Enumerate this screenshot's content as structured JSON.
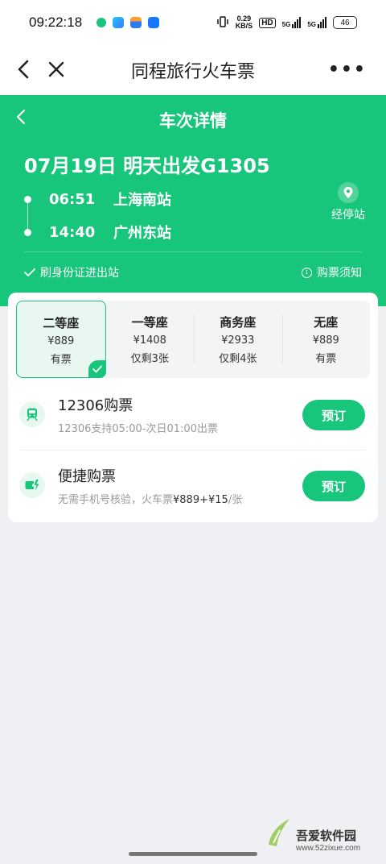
{
  "status_bar": {
    "time": "09:22:18",
    "net_speed_value": "0.29",
    "net_speed_unit": "KB/S",
    "hd": "HD",
    "sig1": "5G",
    "sig2": "5G",
    "battery": "46"
  },
  "nav": {
    "title": "同程旅行火车票",
    "more": "•••"
  },
  "trip": {
    "page_title": "车次详情",
    "date_line": "07月19日 明天出发G1305",
    "depart_time": "06:51",
    "depart_station": "上海南站",
    "arrive_time": "14:40",
    "arrive_station": "广州东站",
    "stops_label": "经停站",
    "id_card_label": "刷身份证进出站",
    "notice_label": "购票须知"
  },
  "seats": [
    {
      "name": "二等座",
      "price": "¥889",
      "stock": "有票",
      "selected": true
    },
    {
      "name": "一等座",
      "price": "¥1408",
      "stock": "仅剩3张",
      "selected": false
    },
    {
      "name": "商务座",
      "price": "¥2933",
      "stock": "仅剩4张",
      "selected": false
    },
    {
      "name": "无座",
      "price": "¥889",
      "stock": "有票",
      "selected": false
    }
  ],
  "channels": {
    "official": {
      "title": "12306购票",
      "desc": "12306支持05:00-次日01:00出票",
      "button": "预订"
    },
    "fast": {
      "title": "便捷购票",
      "desc_prefix": "无需手机号核验，火车票",
      "desc_price": "¥889+¥15",
      "desc_suffix": "/张",
      "button": "预订"
    }
  },
  "watermark": {
    "name": "吾爱软件园",
    "url": "www.52zixue.com"
  },
  "colors": {
    "accent": "#18c67b"
  }
}
